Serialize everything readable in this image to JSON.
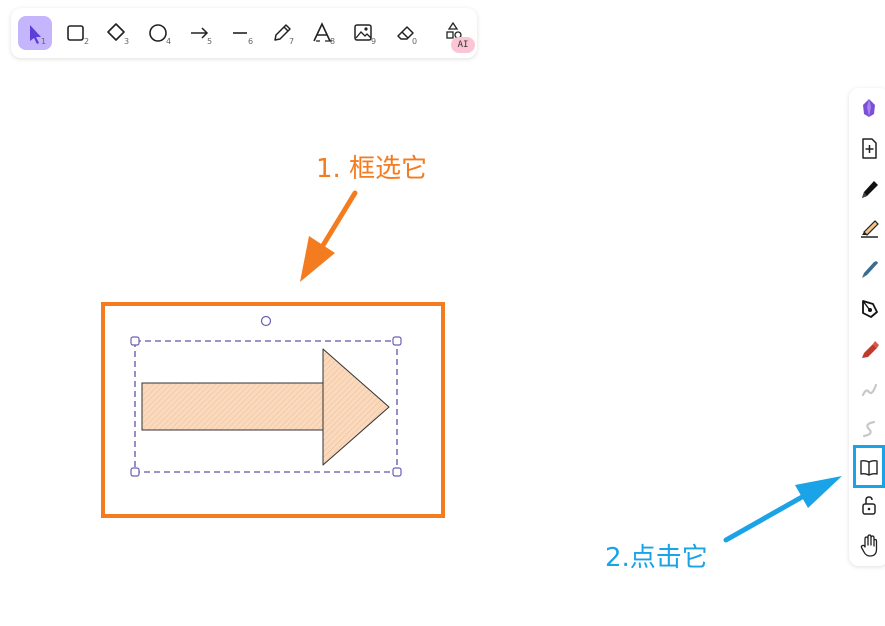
{
  "toolbar": {
    "tools": [
      {
        "icon": "pointer-icon",
        "shortcut": "1",
        "active": true
      },
      {
        "icon": "rectangle-icon",
        "shortcut": "2"
      },
      {
        "icon": "diamond-icon",
        "shortcut": "3"
      },
      {
        "icon": "ellipse-icon",
        "shortcut": "4"
      },
      {
        "icon": "arrow-icon",
        "shortcut": "5"
      },
      {
        "icon": "line-icon",
        "shortcut": "6"
      },
      {
        "icon": "pencil-icon",
        "shortcut": "7"
      },
      {
        "icon": "text-icon",
        "shortcut": "8"
      },
      {
        "icon": "image-icon",
        "shortcut": "9"
      },
      {
        "icon": "eraser-icon",
        "shortcut": "0"
      },
      {
        "icon": "shapes-icon",
        "badge": "AI"
      }
    ]
  },
  "sidebar": {
    "items": [
      {
        "icon": "gem-icon"
      },
      {
        "icon": "file-add-icon"
      },
      {
        "icon": "pen-icon"
      },
      {
        "icon": "highlighter-icon"
      },
      {
        "icon": "marker-icon"
      },
      {
        "icon": "pen-nib-icon"
      },
      {
        "icon": "red-marker-icon"
      },
      {
        "icon": "squiggle-icon"
      },
      {
        "icon": "squiggle-s-icon"
      },
      {
        "icon": "book-icon",
        "highlighted": true
      },
      {
        "icon": "unlock-icon"
      },
      {
        "icon": "hand-icon"
      }
    ]
  },
  "annotations": {
    "step1": "1. 框选它",
    "step2": "2.点击它"
  },
  "colors": {
    "accent_orange": "#f47c20",
    "accent_blue": "#1aa3e6",
    "selection": "#6b5fb3",
    "shape_fill": "#fad9bd",
    "active_tool": "#c4b5fd"
  }
}
